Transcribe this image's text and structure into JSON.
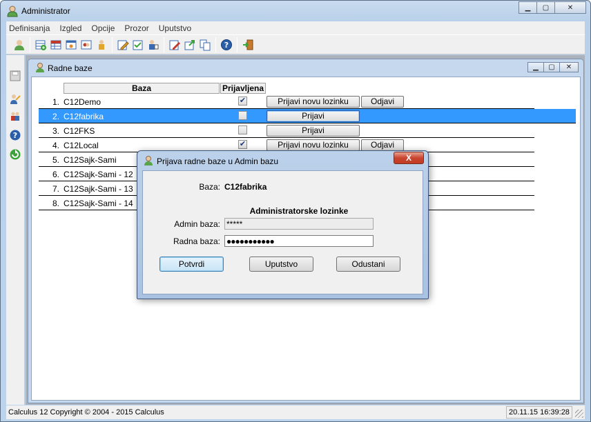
{
  "app": {
    "title": "Administrator",
    "menu": [
      "Definisanja",
      "Izgled",
      "Opcije",
      "Prozor",
      "Uputstvo"
    ]
  },
  "toolbar": {
    "icons": [
      "user-icon",
      "table-add-icon",
      "table-icon",
      "window-icon",
      "users-icon",
      "person-icon",
      "edit-icon",
      "edit-check-icon",
      "user-edit-icon",
      "edit-page-icon",
      "export-icon",
      "copy-icon",
      "help-icon",
      "exit-icon"
    ]
  },
  "leftbar": {
    "icons": [
      "save-icon",
      "people-icon",
      "people-group-icon",
      "help-icon",
      "refresh-icon"
    ]
  },
  "child_window": {
    "title": "Radne baze",
    "columns": {
      "baza": "Baza",
      "prijavljena": "Prijavljena"
    },
    "rows": [
      {
        "num": "1.",
        "name": "C12Demo",
        "checked": true,
        "btn1": "Prijavi novu lozinku",
        "btn2": "Odjavi"
      },
      {
        "num": "2.",
        "name": "C12fabrika",
        "checked": false,
        "btn1": "Prijavi",
        "btn2": ""
      },
      {
        "num": "3.",
        "name": "C12FKS",
        "checked": false,
        "btn1": "Prijavi",
        "btn2": ""
      },
      {
        "num": "4.",
        "name": "C12Local",
        "checked": true,
        "btn1": "Prijavi novu lozinku",
        "btn2": "Odjavi"
      },
      {
        "num": "5.",
        "name": "C12Sajk-Sami"
      },
      {
        "num": "6.",
        "name": "C12Sajk-Sami - 12"
      },
      {
        "num": "7.",
        "name": "C12Sajk-Sami - 13"
      },
      {
        "num": "8.",
        "name": "C12Sajk-Sami - 14"
      }
    ],
    "selected_row": 2
  },
  "dialog": {
    "title": "Prijava radne baze u Admin bazu",
    "close": "X",
    "baza_label": "Baza:",
    "baza_value": "C12fabrika",
    "section_title": "Administratorske lozinke",
    "admin_label": "Admin baza:",
    "admin_value": "*****",
    "radna_label": "Radna baza:",
    "radna_value": "●●●●●●●●●●●",
    "buttons": {
      "confirm": "Potvrdi",
      "help": "Uputstvo",
      "cancel": "Odustani"
    }
  },
  "status": {
    "left": "Calculus 12  Copyright © 2004 - 2015  Calculus",
    "right": "20.11.15 16:39:28"
  }
}
